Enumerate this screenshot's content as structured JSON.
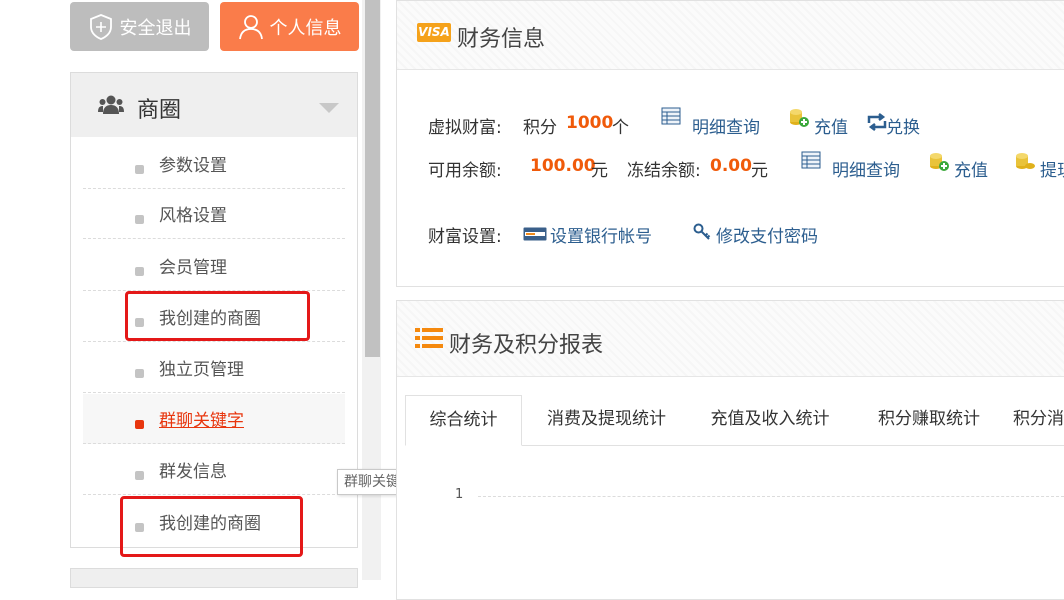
{
  "top_buttons": {
    "logout": "安全退出",
    "profile": "个人信息"
  },
  "sidebar": {
    "title": "商圈",
    "items": [
      {
        "label": "参数设置"
      },
      {
        "label": "风格设置"
      },
      {
        "label": "会员管理"
      },
      {
        "label": "我创建的商圈"
      },
      {
        "label": "独立页管理"
      },
      {
        "label": "群聊关键字",
        "active": true
      },
      {
        "label": "群发信息"
      },
      {
        "label": "我创建的商圈"
      }
    ],
    "tooltip": "群聊关键字"
  },
  "finance": {
    "title": "财务信息",
    "virtual_label": "虚拟财富:",
    "points_label": "积分",
    "points_value": "1000",
    "points_unit": "个",
    "detail": "明细查询",
    "recharge": "充值",
    "exchange": "兑换",
    "balance_label": "可用余额:",
    "balance_value": "100.00",
    "currency": "元",
    "frozen_label": "冻结余额:",
    "frozen_value": "0.00",
    "withdraw": "提现",
    "settings_label": "财富设置:",
    "bank": "设置银行帐号",
    "paypwd": "修改支付密码"
  },
  "report": {
    "title": "财务及积分报表",
    "tabs": [
      "综合统计",
      "消费及提现统计",
      "充值及收入统计",
      "积分赚取统计",
      "积分消费统计"
    ],
    "chart_tick": "1"
  },
  "colors": {
    "accent": "#fa7c4a",
    "highlight": "#f05a0a",
    "active_menu": "#e8360e",
    "annotation_box": "#e41818"
  }
}
